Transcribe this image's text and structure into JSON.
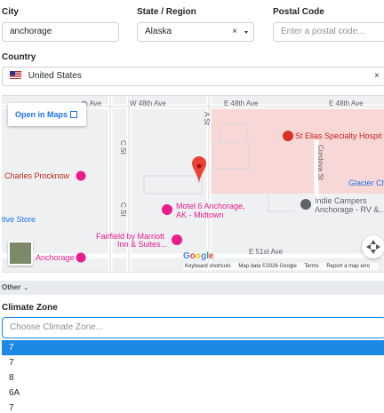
{
  "form": {
    "city": {
      "label": "City",
      "value": "anchorage"
    },
    "state": {
      "label": "State / Region",
      "value": "Alaska",
      "clear": "×"
    },
    "postal": {
      "label": "Postal Code",
      "placeholder": "Enter a postal code..."
    },
    "country": {
      "label": "Country",
      "value": "United States",
      "clear": "×",
      "flag": "us-flag-icon"
    }
  },
  "map": {
    "open_in_maps": "Open in Maps",
    "streets": [
      "th Ave",
      "W 48th Ave",
      "E 48th Ave",
      "E 48th Ave",
      "A St",
      "C St",
      "C St",
      "Cordova St",
      "E 51st Ave"
    ],
    "places": [
      "St Elias Specialty Hospit",
      "Charles Procknow",
      "Glacier Ch",
      "Motel 6 Anchorage,",
      "AK - Midtown",
      "Indie Campers",
      "Anchorage - RV &...",
      "tive Store",
      "Fairfield by Marriott",
      "Inn & Suites...",
      "Anchorage"
    ],
    "google": "Google",
    "attribution": [
      "Keyboard shortcuts",
      "Map data ©2026 Google",
      "Terms",
      "Report a map erro"
    ]
  },
  "other": {
    "label": "Other"
  },
  "climate": {
    "label": "Climate Zone",
    "placeholder": "Choose Climate Zone...",
    "options": [
      "7",
      "7",
      "8",
      "6A",
      "7"
    ]
  },
  "colors": {
    "accent": "#1e88e5",
    "pin": "#ea4335",
    "poi": "#e91e8c"
  }
}
